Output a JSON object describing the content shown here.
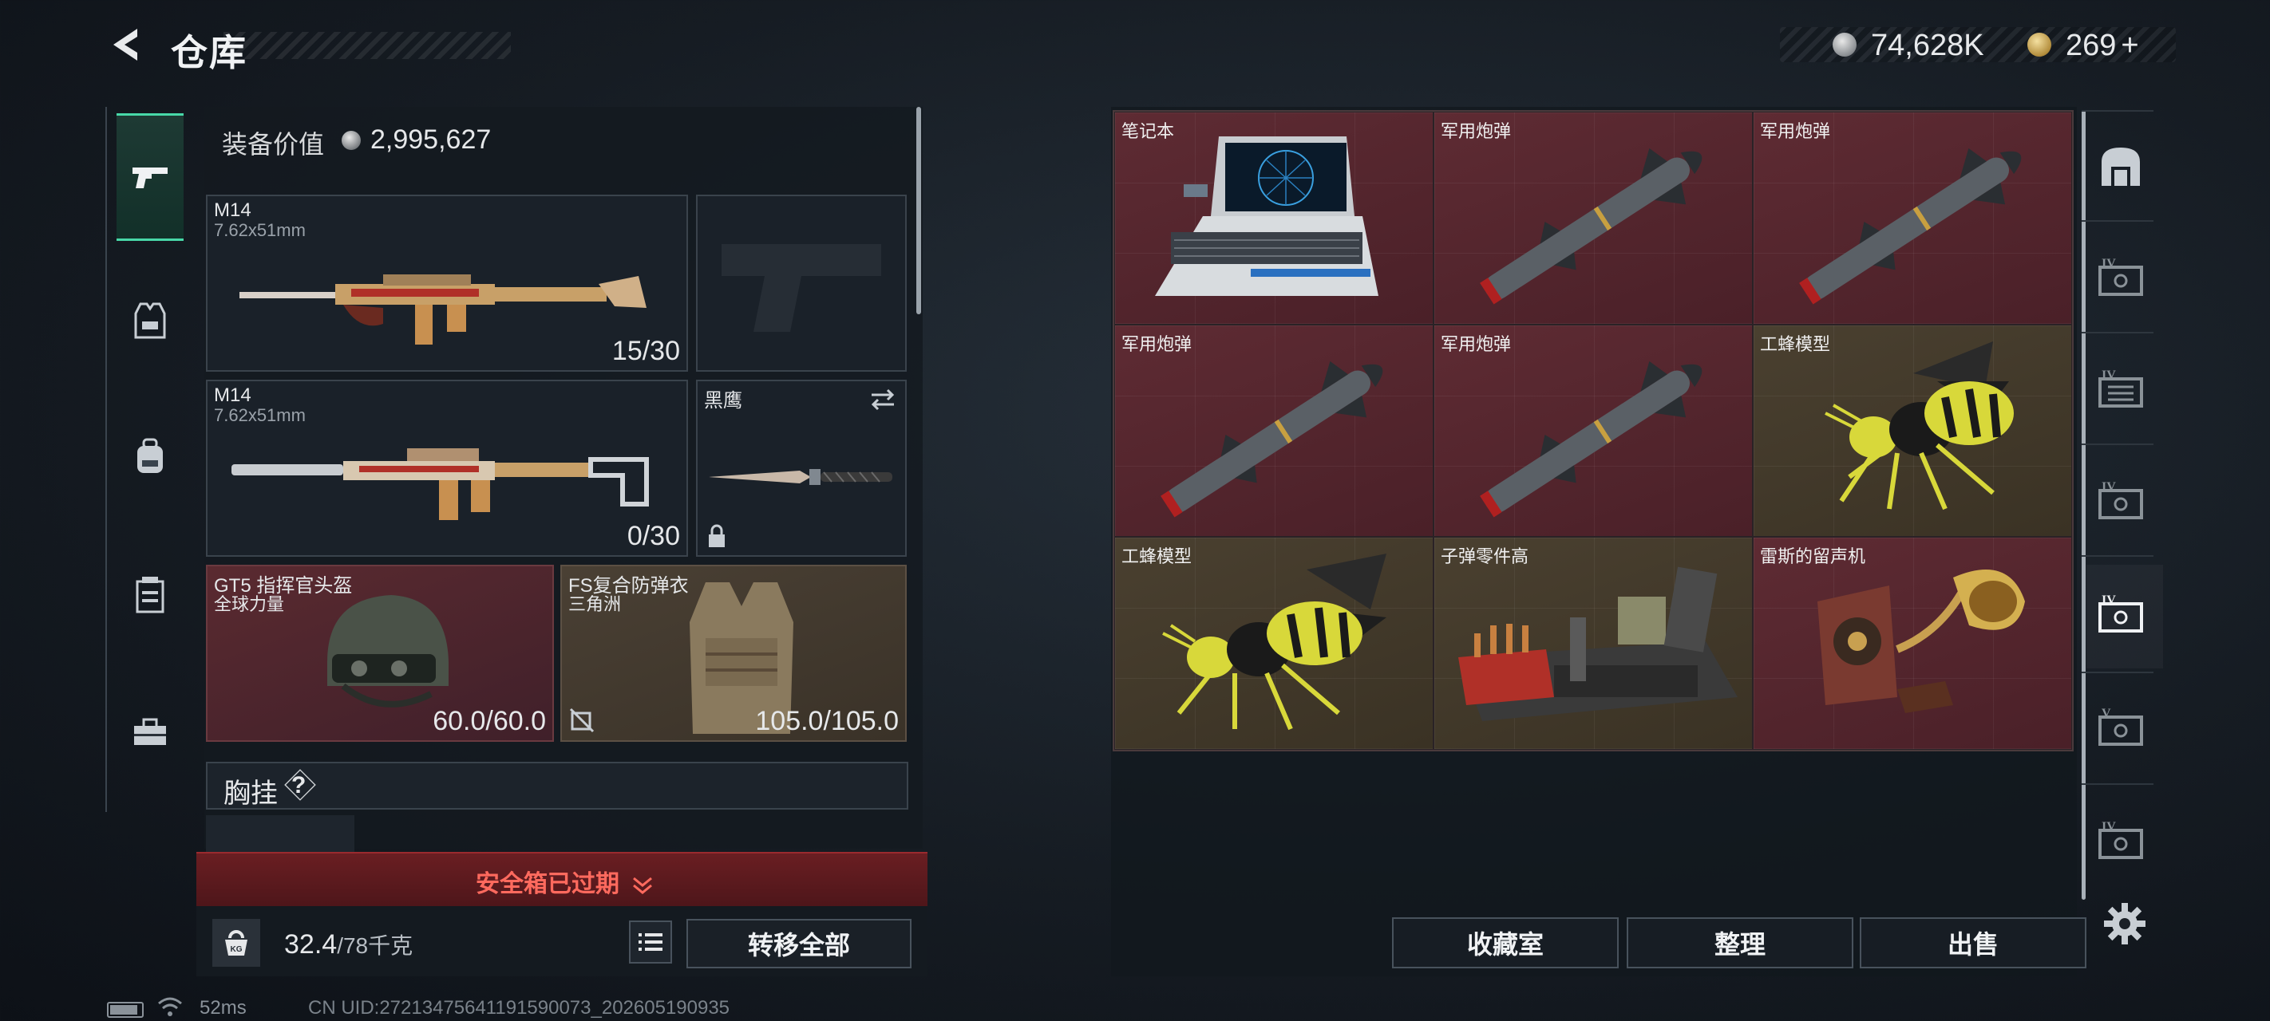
{
  "header": {
    "title": "仓库",
    "currency_silver": "74,628K",
    "currency_gold": "269",
    "gold_plus": "+"
  },
  "equipment": {
    "value_label": "装备价值",
    "value": "2,995,627",
    "primary1": {
      "name": "M14",
      "caliber": "7.62x51mm",
      "ammo": "15/30"
    },
    "primary2": {
      "name": "M14",
      "caliber": "7.62x51mm",
      "ammo": "0/30"
    },
    "melee": {
      "name": "黑鹰"
    },
    "helmet": {
      "name": "GT5 指挥官头盔",
      "sub": "全球力量",
      "durability": "60.0/60.0"
    },
    "armor": {
      "name": "FS复合防弹衣",
      "sub": "三角洲",
      "durability": "105.0/105.0"
    },
    "chest_rig_label": "胸挂",
    "chest_rig_help": "?",
    "safe_box_status": "安全箱已过期",
    "weight_value": "32.4",
    "weight_unit": "/78千克",
    "kg_label": "KG",
    "transfer_all": "转移全部"
  },
  "inventory": {
    "items": [
      {
        "label": "笔记本",
        "rarity": "red",
        "icon": "laptop-icon"
      },
      {
        "label": "军用炮弹",
        "rarity": "red",
        "icon": "missile-icon"
      },
      {
        "label": "军用炮弹",
        "rarity": "red",
        "icon": "missile-icon"
      },
      {
        "label": "军用炮弹",
        "rarity": "red",
        "icon": "missile-icon"
      },
      {
        "label": "军用炮弹",
        "rarity": "red",
        "icon": "missile-icon"
      },
      {
        "label": "工蜂模型",
        "rarity": "olive",
        "icon": "bee-model-icon"
      },
      {
        "label": "工蜂模型",
        "rarity": "olive",
        "icon": "bee-model-icon"
      },
      {
        "label": "子弹零件高",
        "rarity": "olive",
        "icon": "ammo-parts-icon"
      },
      {
        "label": "雷斯的留声机",
        "rarity": "red",
        "icon": "gramophone-icon"
      }
    ],
    "buttons": {
      "collection": "收藏室",
      "sort": "整理",
      "sell": "出售"
    }
  },
  "right_rail": {
    "tabs": [
      "IV",
      "IV",
      "IV",
      "IV",
      "V",
      "IV"
    ]
  },
  "status_bar": {
    "ping": "52ms",
    "uid": "CN UID:27213475641191590073_202605190935"
  },
  "colors": {
    "accent_green": "#48d8a8",
    "rarity_red": "#5e2b33",
    "rarity_olive": "#4a4030",
    "warning_red": "#ff6a5e"
  }
}
